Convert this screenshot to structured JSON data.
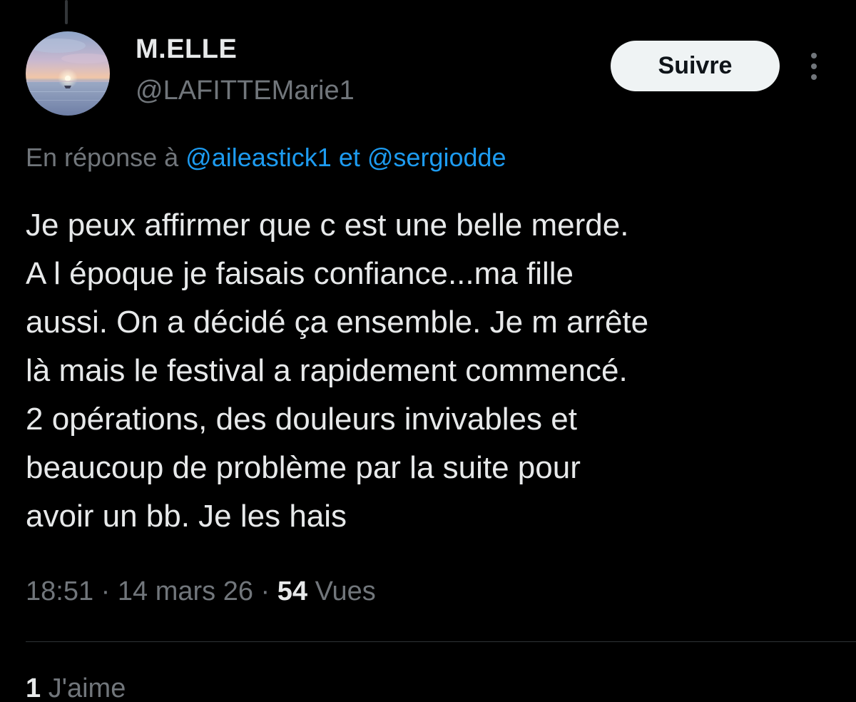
{
  "author": {
    "display_name": "M.ELLE",
    "handle": "@LAFITTEMarie1"
  },
  "follow_button_label": "Suivre",
  "reply_context": {
    "prefix": "En réponse à",
    "mention_1": "@aileastick1",
    "connector": "et",
    "mention_2": "@sergiodde"
  },
  "tweet": {
    "lines": [
      "Je peux affirmer que c est une belle merde.",
      "A l époque je faisais confiance...ma fille",
      "aussi. On a décidé ça ensemble. Je m arrête",
      "là mais le festival a rapidement commencé.",
      "2 opérations,  des douleurs invivables et",
      "beaucoup de problème par la suite pour",
      "avoir un bb. Je les hais"
    ]
  },
  "meta": {
    "time": "18:51",
    "separator": "·",
    "date": "14 mars 26",
    "views_count": "54",
    "views_label": "Vues"
  },
  "likes": {
    "count": "1",
    "label": "J'aime"
  },
  "icons": {
    "avatar": "sunset-sea-photo",
    "more": "more-vertical-icon"
  },
  "colors": {
    "background": "#000000",
    "text_primary": "#e7e9ea",
    "text_secondary": "#71767b",
    "link": "#1d9bf0",
    "button_bg": "#eff3f4"
  }
}
